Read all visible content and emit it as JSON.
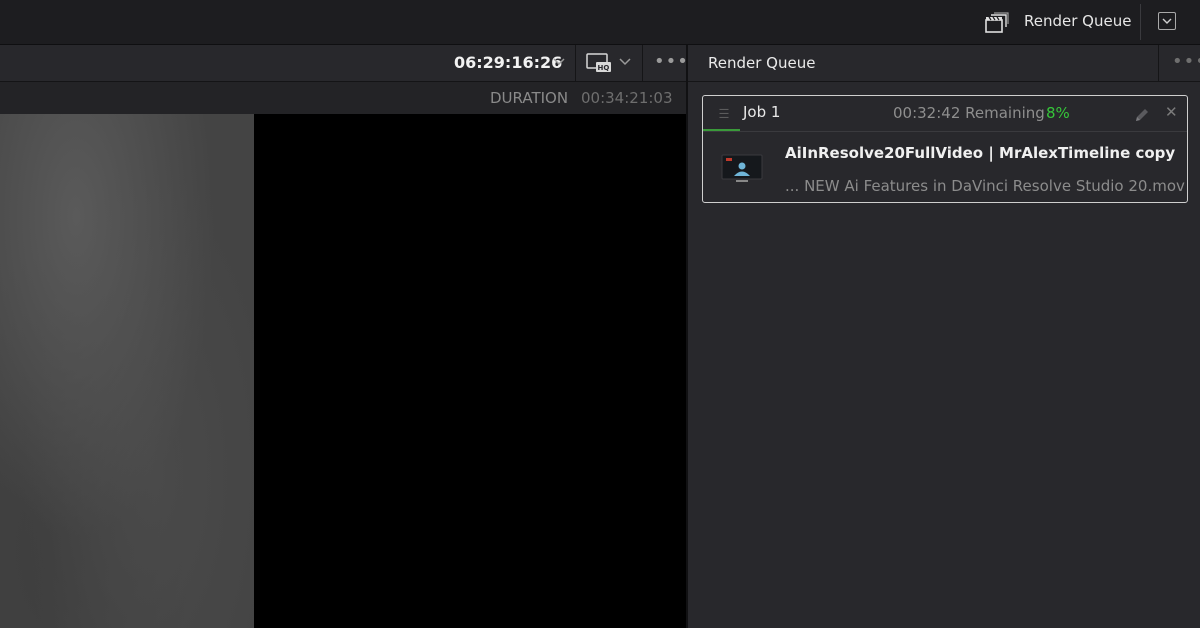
{
  "topbar": {
    "render_queue_label": "Render Queue"
  },
  "viewer": {
    "timecode": "06:29:16:26",
    "options_label": "•••",
    "duration_label": "DURATION",
    "duration_value": "00:34:21:03"
  },
  "render_queue": {
    "title": "Render Queue",
    "options_label": "•••",
    "job": {
      "name": "Job 1",
      "remaining": "00:32:42 Remaining",
      "percent": "8%",
      "close_label": "✕",
      "timeline": "AiInResolve20FullVideo | MrAlexTimeline copy",
      "filename": "... NEW Ai Features in DaVinci Resolve Studio 20.mov"
    }
  },
  "colors": {
    "progress_green": "#36c53a",
    "panel_bg": "#28282c",
    "card_border": "#cfcfcf"
  },
  "icons": {
    "render_queue": "clapperboard-stack-icon",
    "dropdown": "chevron-down-icon",
    "hq": "hq-monitor-icon",
    "edit": "pencil-icon",
    "close": "close-icon",
    "thumb": "timeline-monitor-icon"
  }
}
